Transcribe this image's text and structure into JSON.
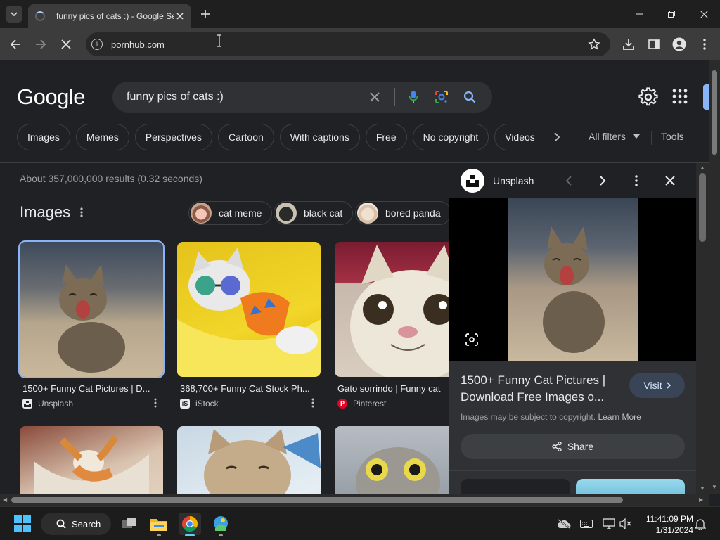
{
  "browser": {
    "tab_title": "funny pics of cats :) - Google Se",
    "url": "pornhub.com"
  },
  "google": {
    "logo": "Google",
    "query": "funny pics of cats :)",
    "chips": [
      "Images",
      "Memes",
      "Perspectives",
      "Cartoon",
      "With captions",
      "Free",
      "No copyright",
      "Videos"
    ],
    "all_filters": "All filters",
    "tools": "Tools",
    "stats": "About 357,000,000 results (0.32 seconds)",
    "images_heading": "Images",
    "related": [
      {
        "label": "cat meme"
      },
      {
        "label": "black cat"
      },
      {
        "label": "bored panda"
      }
    ],
    "results": [
      {
        "title": "1500+ Funny Cat Pictures | D...",
        "source": "Unsplash"
      },
      {
        "title": "368,700+ Funny Cat Stock Ph...",
        "source": "iStock"
      },
      {
        "title": "Gato sorrindo | Funny cat",
        "source": "Pinterest"
      }
    ]
  },
  "panel": {
    "source": "Unsplash",
    "title": "1500+ Funny Cat Pictures | Download Free Images o...",
    "visit": "Visit",
    "copyright": "Images may be subject to copyright.",
    "learn_more": "Learn More",
    "share": "Share"
  },
  "taskbar": {
    "search": "Search",
    "time": "11:41:09 PM",
    "date": "1/31/2024"
  },
  "colors": {
    "accent": "#8ab4f8",
    "page_bg": "#202124",
    "panel_bg": "#303134"
  }
}
